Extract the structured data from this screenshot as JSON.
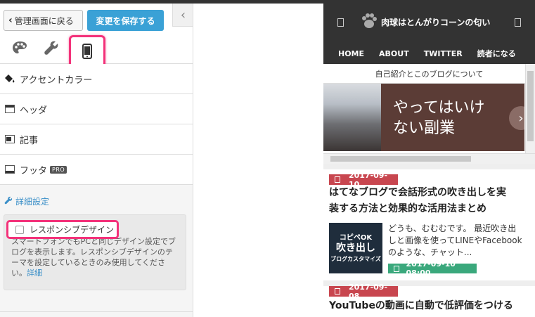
{
  "panel": {
    "back_label": "管理画面に戻る",
    "save_label": "変更を保存する",
    "collapse_label": "‹",
    "menu": [
      {
        "label": "アクセントカラー",
        "icon": "paint-bucket-icon",
        "pro": ""
      },
      {
        "label": "ヘッダ",
        "icon": "header-layout-icon",
        "pro": ""
      },
      {
        "label": "記事",
        "icon": "article-layout-icon",
        "pro": ""
      },
      {
        "label": "フッタ",
        "icon": "footer-layout-icon",
        "pro": "PRO"
      }
    ],
    "detail_title": "詳細設定",
    "responsive_label": "レスポンシブデザイン",
    "responsive_desc": "スマートフォンでもPCと同じデザイン設定でブログを表示します。レスポンシブデザインのテーマを設定しているときのみ使用してください。",
    "responsive_link": "詳細"
  },
  "blog": {
    "title": "肉球はとんがりコーンの匂い",
    "nav": [
      "HOME",
      "ABOUT",
      "TWITTER",
      "読者になる"
    ],
    "intro": "自己紹介とこのブログについて",
    "slide_text_line1": "やってはいけ",
    "slide_text_line2": "ない副業",
    "slide_arrow": "›",
    "post1": {
      "date": "2017-09-10",
      "title_line1": "はてなブログで会話形式の吹き出しを実",
      "title_line2": "装する方法と効果的な活用法まとめ",
      "thumb_line1": "コピペOK",
      "thumb_line2": "吹き出し",
      "thumb_line3": "ブログカスタマイズ",
      "excerpt_line1": "どうも、むむむです。 最近吹き出",
      "excerpt_line2": "しと画像を使ってLINEやFacebook",
      "excerpt_line3": "のような、チャット...",
      "datetime": "2017-09-10 08:00"
    },
    "post2": {
      "date": "2017-09-08",
      "title_line1": "YouTubeの動画に自動で低評価をつける"
    }
  },
  "colors": {
    "accent_blue": "#3aa1d6",
    "highlight_pink": "#f3327a",
    "date_red": "#c8464f",
    "date_green": "#3aa87c",
    "header_dark": "#333333"
  }
}
